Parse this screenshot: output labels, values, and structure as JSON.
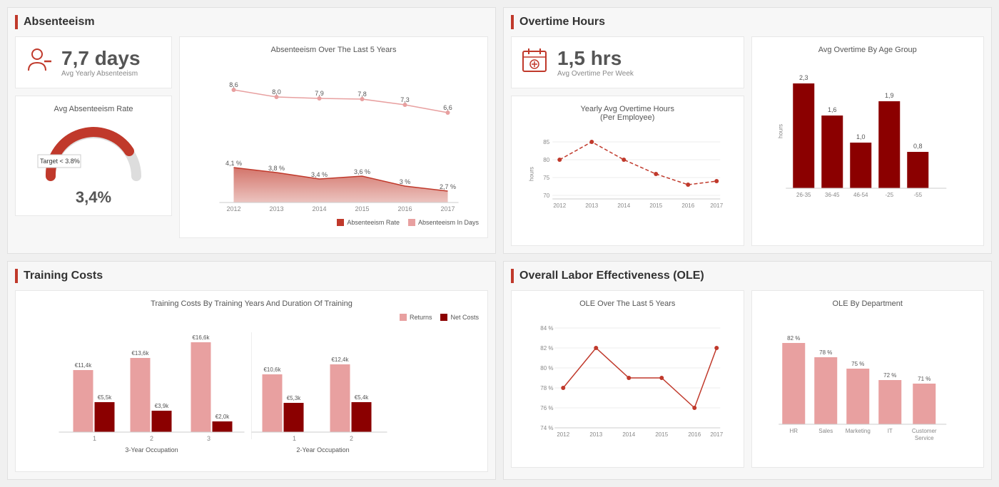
{
  "absenteeism": {
    "title": "Absenteeism",
    "stat_value": "7,7 days",
    "stat_label": "Avg Yearly Absenteeism",
    "gauge_title": "Avg Absenteeism Rate",
    "gauge_value": "3,4%",
    "target_label": "Target < 3.8%",
    "chart_title": "Absenteeism Over The Last 5 Years",
    "legend_rate": "Absenteeism Rate",
    "legend_days": "Absenteeism In Days",
    "years": [
      "2012",
      "2013",
      "2014",
      "2015",
      "2016",
      "2017"
    ],
    "days_values": [
      8.6,
      8.0,
      7.9,
      7.8,
      7.3,
      6.6
    ],
    "rate_values": [
      4.1,
      3.8,
      3.4,
      3.6,
      3.0,
      2.7
    ]
  },
  "overtime": {
    "title": "Overtime Hours",
    "stat_value": "1,5 hrs",
    "stat_label": "Avg Overtime Per Week",
    "yearly_chart_title": "Yearly Avg Overtime Hours\n(Per Employee)",
    "age_chart_title": "Avg Overtime By Age Group",
    "yearly_years": [
      "2012",
      "2013",
      "2014",
      "2015",
      "2016",
      "2017"
    ],
    "yearly_values": [
      80,
      85,
      80,
      76,
      73,
      74
    ],
    "age_groups": [
      "26-35",
      "36-45",
      "46-54",
      "-25",
      "-55"
    ],
    "age_values": [
      2.3,
      1.6,
      1.0,
      1.9,
      0.8
    ],
    "y_axis_labels": [
      "85",
      "80",
      "75",
      "70"
    ]
  },
  "training": {
    "title": "Training Costs",
    "chart_title": "Training Costs By Training Years And Duration Of Training",
    "legend_returns": "Returns",
    "legend_net": "Net Costs",
    "x_label_3year": "3-Year Occupation",
    "x_label_2year": "2-Year Occupation",
    "groups_3year": [
      {
        "x_label": "1",
        "returns": 11.4,
        "net": 5.5
      },
      {
        "x_label": "2",
        "returns": 13.6,
        "net": 3.9
      },
      {
        "x_label": "3",
        "returns": 16.6,
        "net": 2.0
      }
    ],
    "groups_2year": [
      {
        "x_label": "1",
        "returns": 10.6,
        "net": 5.3
      },
      {
        "x_label": "2",
        "returns": 12.4,
        "net": 5.4
      }
    ]
  },
  "ole": {
    "title": "Overall Labor Effectiveness (OLE)",
    "line_chart_title": "OLE Over The Last 5 Years",
    "bar_chart_title": "OLE By Department",
    "years": [
      "2012",
      "2013",
      "2014",
      "2015",
      "2016",
      "2017"
    ],
    "ole_values": [
      78,
      82,
      79,
      79,
      76,
      82
    ],
    "y_axis": [
      "84%",
      "82%",
      "80%",
      "78%",
      "76%",
      "74%"
    ],
    "departments": [
      "HR",
      "Sales",
      "Marketing",
      "IT",
      "Customer\nService"
    ],
    "dept_values": [
      82,
      78,
      75,
      72,
      71
    ]
  }
}
